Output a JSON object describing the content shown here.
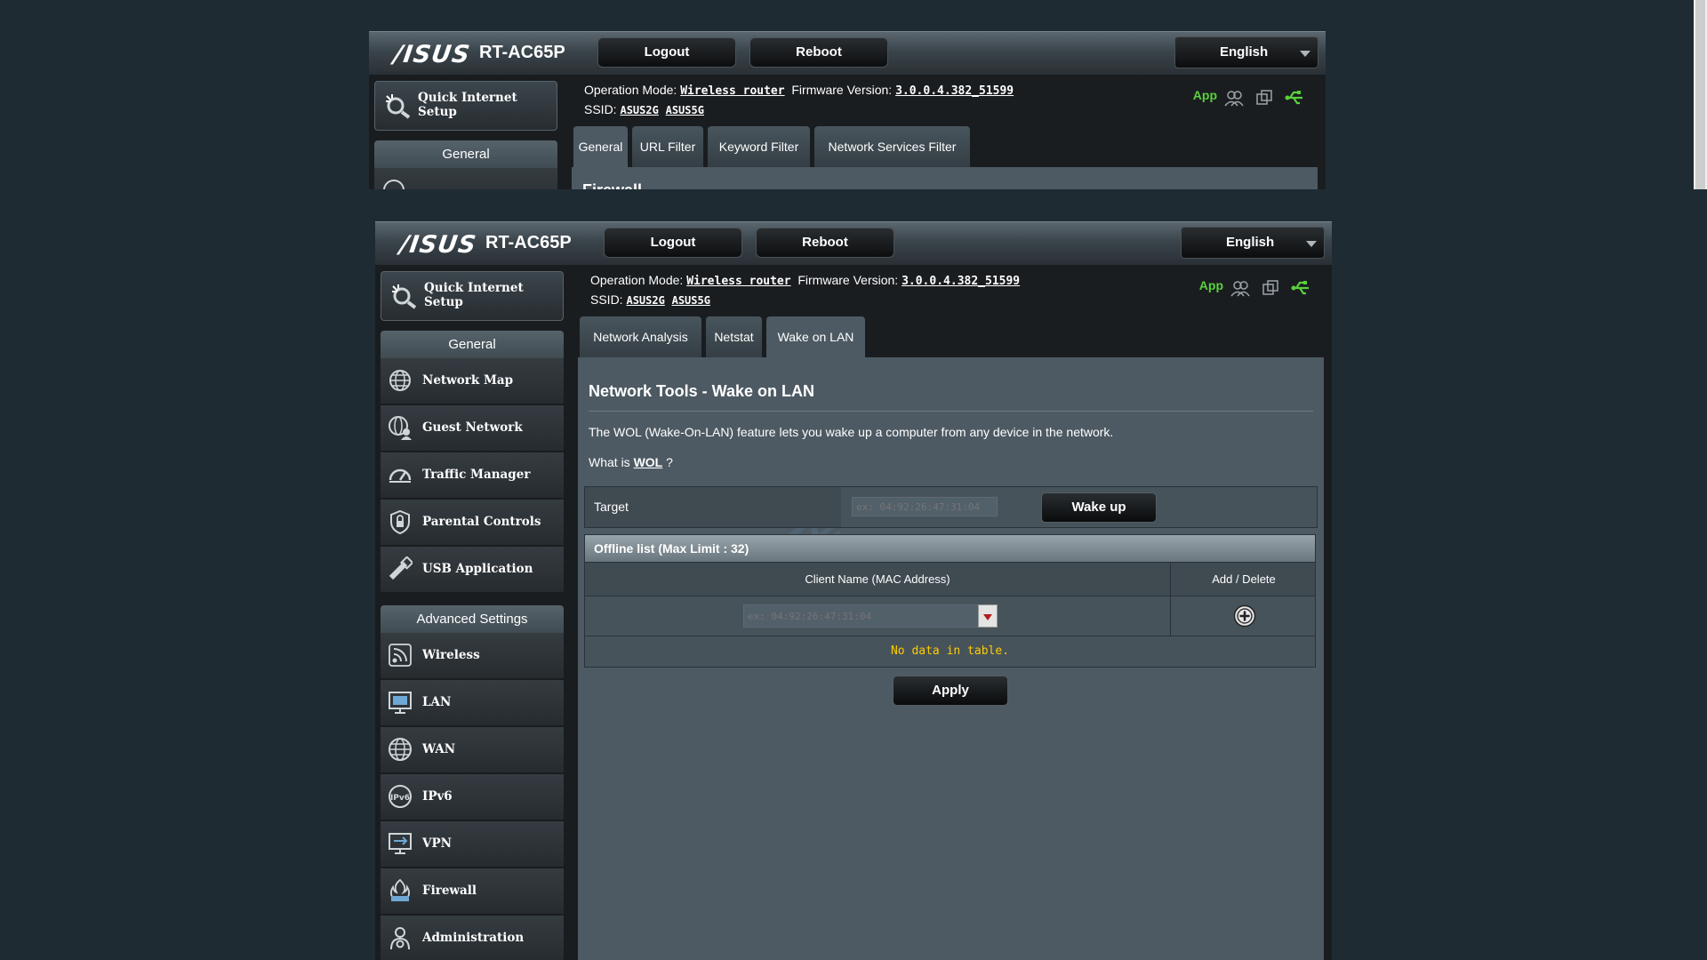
{
  "header": {
    "logo": "/ISUS",
    "model": "RT-AC65P",
    "logout_label": "Logout",
    "reboot_label": "Reboot",
    "language": "English"
  },
  "info": {
    "operation_mode_label": "Operation Mode:",
    "operation_mode": "Wireless router",
    "firmware_label": "Firmware Version:",
    "firmware": "3.0.0.4.382_51599",
    "ssid_label": "SSID:",
    "ssid_2g": "ASUS2G",
    "ssid_5g": "ASUS5G",
    "app_label": "App"
  },
  "sidebar": {
    "quick_setup": "Quick Internet Setup",
    "general_header": "General",
    "general_items": [
      {
        "label": "Network Map",
        "icon": "globe-network-icon"
      },
      {
        "label": "Guest Network",
        "icon": "guest-network-icon"
      },
      {
        "label": "Traffic Manager",
        "icon": "gauge-icon"
      },
      {
        "label": "Parental Controls",
        "icon": "lock-shield-icon"
      },
      {
        "label": "USB Application",
        "icon": "usb-icon"
      }
    ],
    "advanced_header": "Advanced Settings",
    "advanced_items": [
      {
        "label": "Wireless",
        "icon": "wireless-icon"
      },
      {
        "label": "LAN",
        "icon": "lan-icon"
      },
      {
        "label": "WAN",
        "icon": "wan-globe-icon"
      },
      {
        "label": "IPv6",
        "icon": "ipv6-icon"
      },
      {
        "label": "VPN",
        "icon": "vpn-icon"
      },
      {
        "label": "Firewall",
        "icon": "firewall-icon"
      },
      {
        "label": "Administration",
        "icon": "admin-icon"
      }
    ]
  },
  "bg_window": {
    "tabs": [
      "General",
      "URL Filter",
      "Keyword Filter",
      "Network Services Filter"
    ],
    "partial_title": "Firewall"
  },
  "main": {
    "tabs": [
      "Network Analysis",
      "Netstat",
      "Wake on LAN"
    ],
    "active_tab": "Wake on LAN",
    "title": "Network Tools - Wake on LAN",
    "description": "The WOL (Wake-On-LAN) feature lets you wake up a computer from any device in the network.",
    "what_is_prefix": "What is",
    "what_is_link": "WOL",
    "what_is_suffix": "?",
    "target_label": "Target",
    "target_placeholder": "ex: 04:92:26:47:31:04",
    "wake_button": "Wake up",
    "offline_header": "Offline list (Max Limit : 32)",
    "col_client": "Client Name (MAC Address)",
    "col_add_delete": "Add / Delete",
    "mac_placeholder": "ex: 04:92:26:47:31:04",
    "no_data": "No data in table.",
    "apply_button": "Apply"
  },
  "colors": {
    "background": "#1f2b33",
    "content_panel": "#4d5a63",
    "app_green": "#5ad03c",
    "no_data_yellow": "#ffcc00",
    "dropdown_red": "#b31b1b"
  }
}
